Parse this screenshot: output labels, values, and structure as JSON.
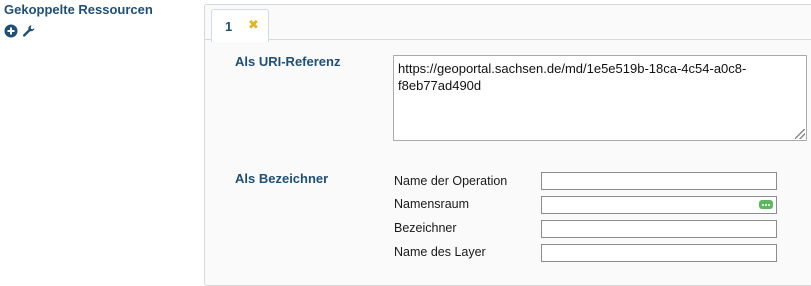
{
  "section": {
    "title": "Gekoppelte Ressourcen",
    "icons": [
      "add-circle-icon",
      "wrench-icon"
    ]
  },
  "tabs": [
    {
      "label": "1",
      "close_icon": "close-icon"
    }
  ],
  "uri": {
    "label": "Als URI-Referenz",
    "value": "https://geoportal.sachsen.de/md/1e5e519b-18ca-4c54-a0c8-f8eb77ad490d"
  },
  "identifier": {
    "label": "Als Bezeichner",
    "fields": [
      {
        "label": "Name der Operation",
        "value": ""
      },
      {
        "label": "Namensraum",
        "value": ""
      },
      {
        "label": "Bezeichner",
        "value": ""
      },
      {
        "label": "Name des Layer",
        "value": ""
      }
    ]
  },
  "colors": {
    "heading": "#1f4f74",
    "close_x": "#e6b422",
    "dots_button": "#5cb85c"
  }
}
